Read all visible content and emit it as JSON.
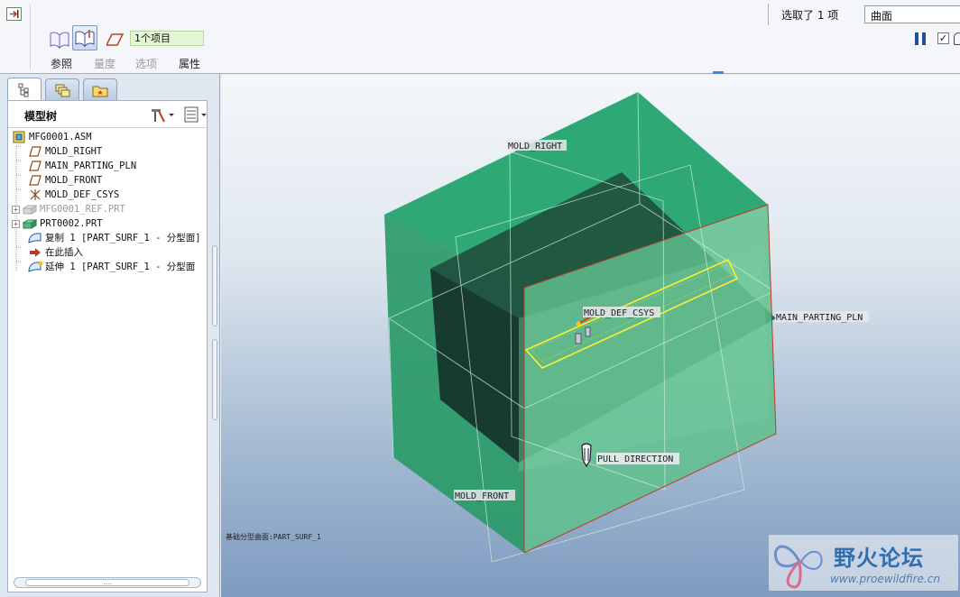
{
  "dashboard": {
    "items_field": "1个项目",
    "tabs": [
      {
        "label": "参照",
        "enabled": true
      },
      {
        "label": "量度",
        "enabled": false
      },
      {
        "label": "选项",
        "enabled": false
      },
      {
        "label": "属性",
        "enabled": true
      }
    ],
    "selection_count": "选取了 1 项",
    "filter_value": "曲面",
    "pause_icon": "pause-icon",
    "check_icon": "check-icon",
    "check_glyph": "✓"
  },
  "navigator": {
    "title": "模型树",
    "tabs": [
      "model-tree-icon",
      "layers-icon",
      "favorites-icon"
    ],
    "scroll_glyph": "....",
    "tree": [
      {
        "label": "MFG0001.ASM",
        "icon": "assembly-icon",
        "dim": false,
        "expander": false
      },
      {
        "label": "MOLD_RIGHT",
        "icon": "datum-plane-icon",
        "dim": false,
        "expander": false
      },
      {
        "label": "MAIN_PARTING_PLN",
        "icon": "datum-plane-icon",
        "dim": false,
        "expander": false
      },
      {
        "label": "MOLD_FRONT",
        "icon": "datum-plane-icon",
        "dim": false,
        "expander": false
      },
      {
        "label": "MOLD_DEF_CSYS",
        "icon": "csys-icon",
        "dim": false,
        "expander": false
      },
      {
        "label": "MFG0001_REF.PRT",
        "icon": "part-icon",
        "dim": true,
        "expander": true
      },
      {
        "label": "PRT0002.PRT",
        "icon": "part-icon",
        "dim": false,
        "expander": true
      },
      {
        "label": "复制 1 [PART_SURF_1 - 分型面]",
        "icon": "surface-icon",
        "dim": false,
        "expander": false
      },
      {
        "label": "在此插入",
        "icon": "insert-here-icon",
        "dim": false,
        "expander": false
      },
      {
        "label": "延伸 1 [PART_SURF_1 - 分型面",
        "icon": "surface-icon",
        "dim": false,
        "expander": false
      }
    ]
  },
  "graphics": {
    "labels": {
      "mold_right": "MOLD_RIGHT",
      "main_parting": "MAIN_PARTING_PLN",
      "mold_def_csys": "MOLD_DEF_CSYS",
      "pull_direction": "PULL DIRECTION",
      "mold_front": "MOLD_FRONT"
    },
    "status_message": "基础分型曲面:PART_SURF_1",
    "colors": {
      "mold_top": "#2ea874",
      "mold_left": "#2a9a69",
      "mold_front": "#5cbf8a",
      "cavity": "#1d4a3a",
      "edge_red": "#c0392b",
      "select_yellow": "#ffee33"
    }
  },
  "watermark": {
    "title": "野火论坛",
    "url": "www.proewildfire.cn"
  }
}
